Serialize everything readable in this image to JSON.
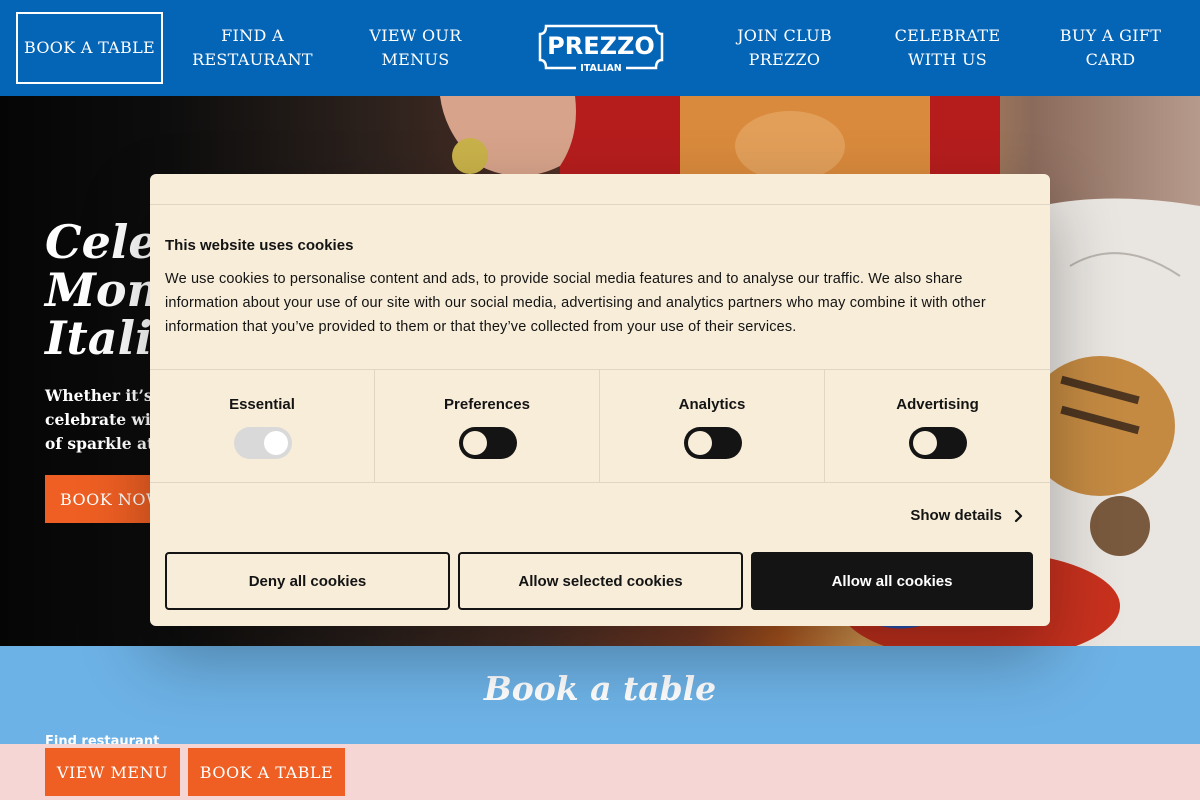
{
  "nav": {
    "book_table": "BOOK A TABLE",
    "find_restaurant": "FIND A RESTAURANT",
    "view_menus": "VIEW OUR MENUS",
    "logo_text": "PREZZO",
    "logo_sub": "ITALIAN",
    "join_club": "JOIN CLUB PREZZO",
    "celebrate": "CELEBRATE WITH US",
    "gift_card": "BUY A GIFT CARD"
  },
  "hero": {
    "title_lines": [
      "Celebrate",
      "Moments",
      "Italian"
    ],
    "text_lines": [
      "Whether it’s a",
      "celebrate with",
      "of sparkle at P"
    ],
    "cta": "BOOK NOW"
  },
  "book_section": {
    "title": "Book a table",
    "find_label": "Find restaurant"
  },
  "bottom_bar": {
    "view_menu": "VIEW MENU",
    "book_table": "BOOK A TABLE"
  },
  "cookie_dialog": {
    "title": "This website uses cookies",
    "body": "We use cookies to personalise content and ads, to provide social media features and to analyse our traffic. We also share information about your use of our site with our social media, advertising and analytics partners who may combine it with other information that you’ve provided to them or that they’ve collected from your use of their services.",
    "categories": [
      {
        "label": "Essential",
        "enabled": true,
        "locked": true
      },
      {
        "label": "Preferences",
        "enabled": false,
        "locked": false
      },
      {
        "label": "Analytics",
        "enabled": false,
        "locked": false
      },
      {
        "label": "Advertising",
        "enabled": false,
        "locked": false
      }
    ],
    "show_details": "Show details",
    "deny_all": "Deny all cookies",
    "allow_selected": "Allow selected cookies",
    "allow_all": "Allow all cookies"
  },
  "colors": {
    "nav_blue": "#0465b7",
    "cta_orange": "#ef5f23",
    "section_blue": "#6db2e6",
    "bottom_pink": "#f6d6d4",
    "dialog_cream": "#f7edd9",
    "dialog_dark": "#141414"
  },
  "icons": {
    "show_details": "chevron-right-icon"
  }
}
